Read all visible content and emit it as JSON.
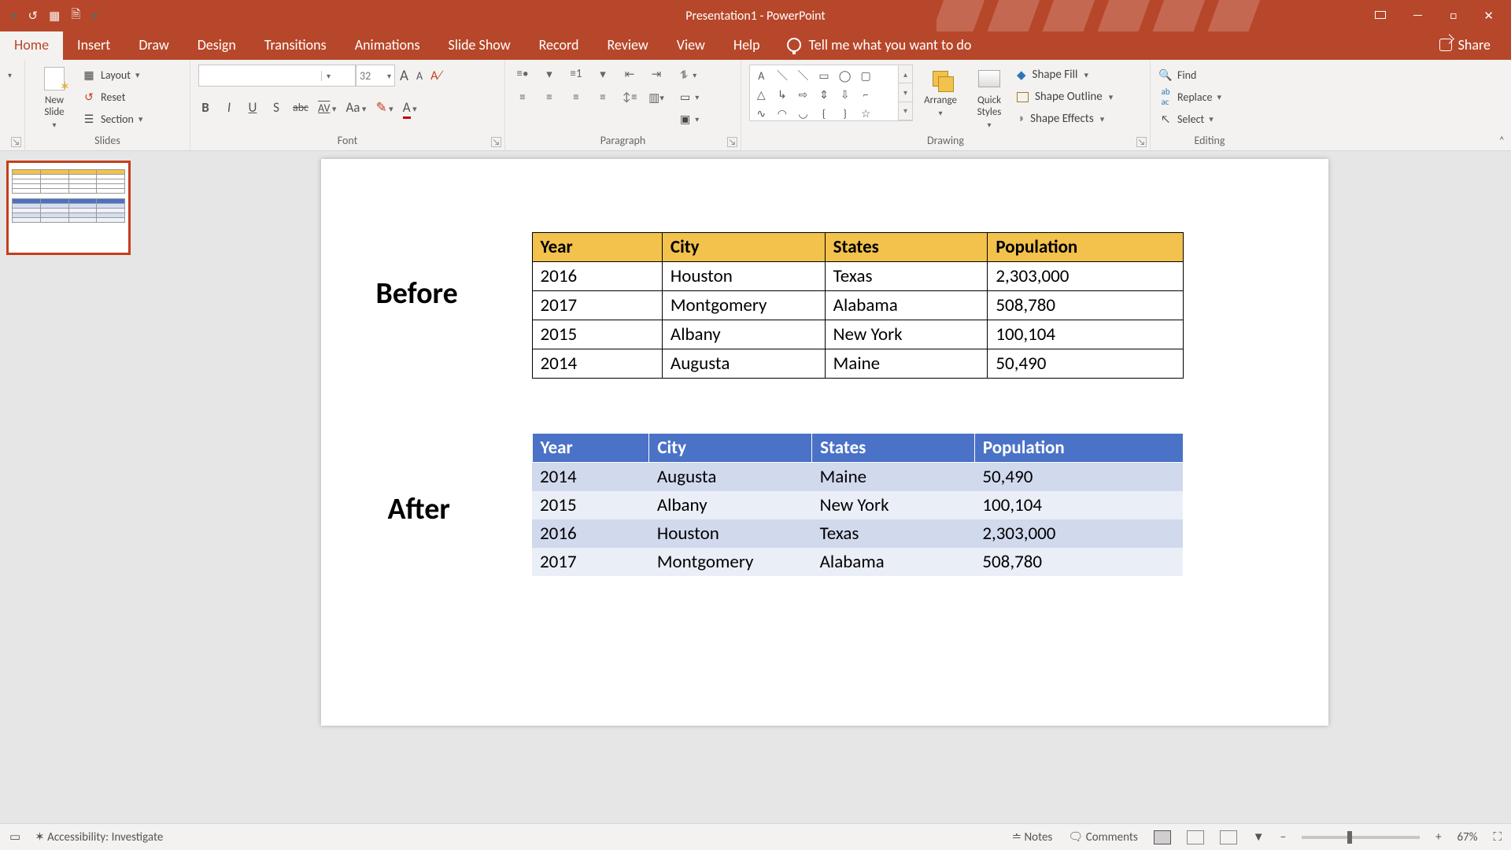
{
  "title": "Presentation1  -  PowerPoint",
  "qat": {
    "undo": "↺",
    "start": "▦",
    "new_doc": "🗎",
    "more": "▾"
  },
  "win": {
    "displayopts": "▭",
    "min": "—",
    "max": "□",
    "close": "✕"
  },
  "tabs": {
    "home": "Home",
    "insert": "Insert",
    "draw": "Draw",
    "design": "Design",
    "transitions": "Transitions",
    "animations": "Animations",
    "slideshow": "Slide Show",
    "record": "Record",
    "review": "Review",
    "view": "View",
    "help": "Help",
    "tellme": "Tell me what you want to do",
    "share": "Share"
  },
  "ribbon": {
    "slides": {
      "new_slide": "New\nSlide",
      "layout": "Layout",
      "reset": "Reset",
      "section": "Section",
      "group": "Slides"
    },
    "font": {
      "size": "32",
      "bold": "B",
      "italic": "I",
      "underline": "U",
      "shadow": "S",
      "strike": "abc",
      "spacing": "AV",
      "case": "Aa",
      "clearfmt": "A",
      "group": "Font",
      "growA": "A",
      "shrinkA": "A",
      "highlighter": "✎"
    },
    "para": {
      "group": "Paragraph"
    },
    "drawing": {
      "arrange": "Arrange",
      "quick": "Quick\nStyles",
      "fill": "Shape Fill",
      "outline": "Shape Outline",
      "effects": "Shape Effects",
      "group": "Drawing"
    },
    "editing": {
      "find": "Find",
      "replace": "Replace",
      "select": "Select",
      "group": "Editing"
    }
  },
  "slide": {
    "before_label": "Before",
    "after_label": "After",
    "headers": [
      "Year",
      "City",
      "States",
      "Population"
    ],
    "before_rows": [
      [
        "2016",
        "Houston",
        "Texas",
        "2,303,000"
      ],
      [
        "2017",
        "Montgomery",
        "Alabama",
        "508,780"
      ],
      [
        "2015",
        "Albany",
        "New York",
        "100,104"
      ],
      [
        "2014",
        "Augusta",
        "Maine",
        "50,490"
      ]
    ],
    "after_rows": [
      [
        "2014",
        "Augusta",
        "Maine",
        "50,490"
      ],
      [
        "2015",
        "Albany",
        "New York",
        "100,104"
      ],
      [
        "2016",
        "Houston",
        "Texas",
        "2,303,000"
      ],
      [
        "2017",
        "Montgomery",
        "Alabama",
        "508,780"
      ]
    ]
  },
  "status": {
    "accessibility": "Accessibility: Investigate",
    "notes": "Notes",
    "comments": "Comments",
    "zoom": "67%"
  }
}
